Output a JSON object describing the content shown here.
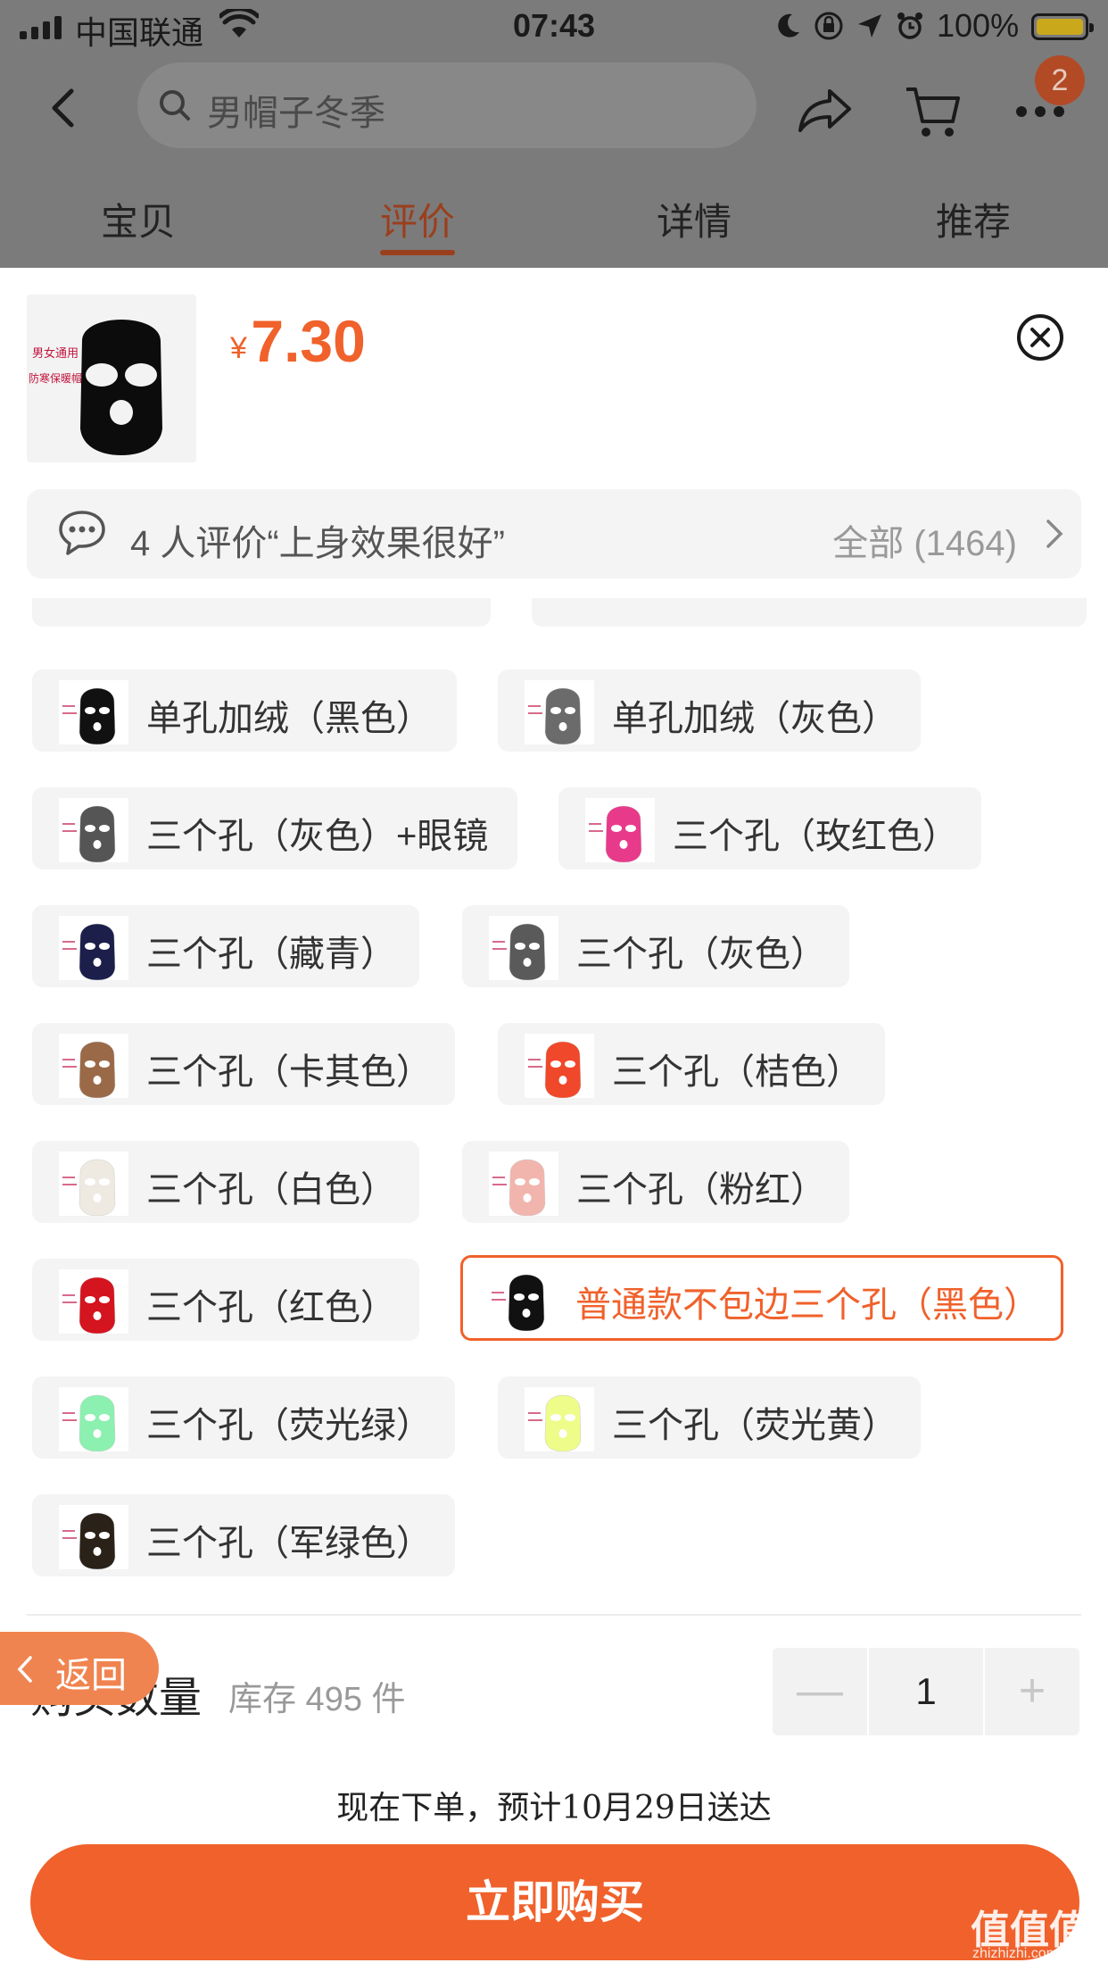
{
  "status_bar": {
    "carrier": "中国联通",
    "time": "07:43",
    "battery": "100%"
  },
  "nav": {
    "search_placeholder": "男帽子冬季",
    "cart_badge": "2"
  },
  "tabs": [
    {
      "label": "宝贝",
      "active": false
    },
    {
      "label": "评价",
      "active": true
    },
    {
      "label": "详情",
      "active": false
    },
    {
      "label": "推荐",
      "active": false
    }
  ],
  "product": {
    "currency": "¥",
    "price": "7.30",
    "thumb_text_line1": "男女通用",
    "thumb_text_line2": "防寒保暖帽子"
  },
  "review_bar": {
    "text": "4 人评价“上身效果很好”",
    "all_label": "全部 (1464)"
  },
  "options": [
    {
      "label": "单孔加绒（黑色）",
      "color": "#111111",
      "selected": false
    },
    {
      "label": "单孔加绒（灰色）",
      "color": "#6b6b6b",
      "selected": false
    },
    {
      "label": "三个孔（灰色）+眼镜",
      "color": "#555555",
      "selected": false
    },
    {
      "label": "三个孔（玫红色）",
      "color": "#e83a8a",
      "selected": false
    },
    {
      "label": "三个孔（藏青）",
      "color": "#1c1f4a",
      "selected": false
    },
    {
      "label": "三个孔（灰色）",
      "color": "#5a5a5a",
      "selected": false
    },
    {
      "label": "三个孔（卡其色）",
      "color": "#9a6a48",
      "selected": false
    },
    {
      "label": "三个孔（桔色）",
      "color": "#f0482a",
      "selected": false
    },
    {
      "label": "三个孔（白色）",
      "color": "#eeeae2",
      "selected": false
    },
    {
      "label": "三个孔（粉红）",
      "color": "#f2b5ad",
      "selected": false
    },
    {
      "label": "三个孔（红色）",
      "color": "#d4141f",
      "selected": false
    },
    {
      "label": "普通款不包边三个孔（黑色）",
      "color": "#111111",
      "selected": true
    },
    {
      "label": "三个孔（荧光绿）",
      "color": "#8cf0b0",
      "selected": false
    },
    {
      "label": "三个孔（荧光黄）",
      "color": "#eefc8a",
      "selected": false
    },
    {
      "label": "三个孔（军绿色）",
      "color": "#2a2118",
      "selected": false
    }
  ],
  "quantity": {
    "label": "购买数量",
    "stock": "库存 495 件",
    "value": "1",
    "minus": "—",
    "plus": "+"
  },
  "back_button": "返回",
  "delivery": "现在下单，预计10月29日送达",
  "buy_button": "立即购买",
  "watermark": "值值值",
  "watermark_url": "zhizhizhi.com",
  "colors": {
    "accent": "#f0612b",
    "overlay_gray": "#7b7b7b",
    "chip_bg": "#f4f4f4"
  }
}
